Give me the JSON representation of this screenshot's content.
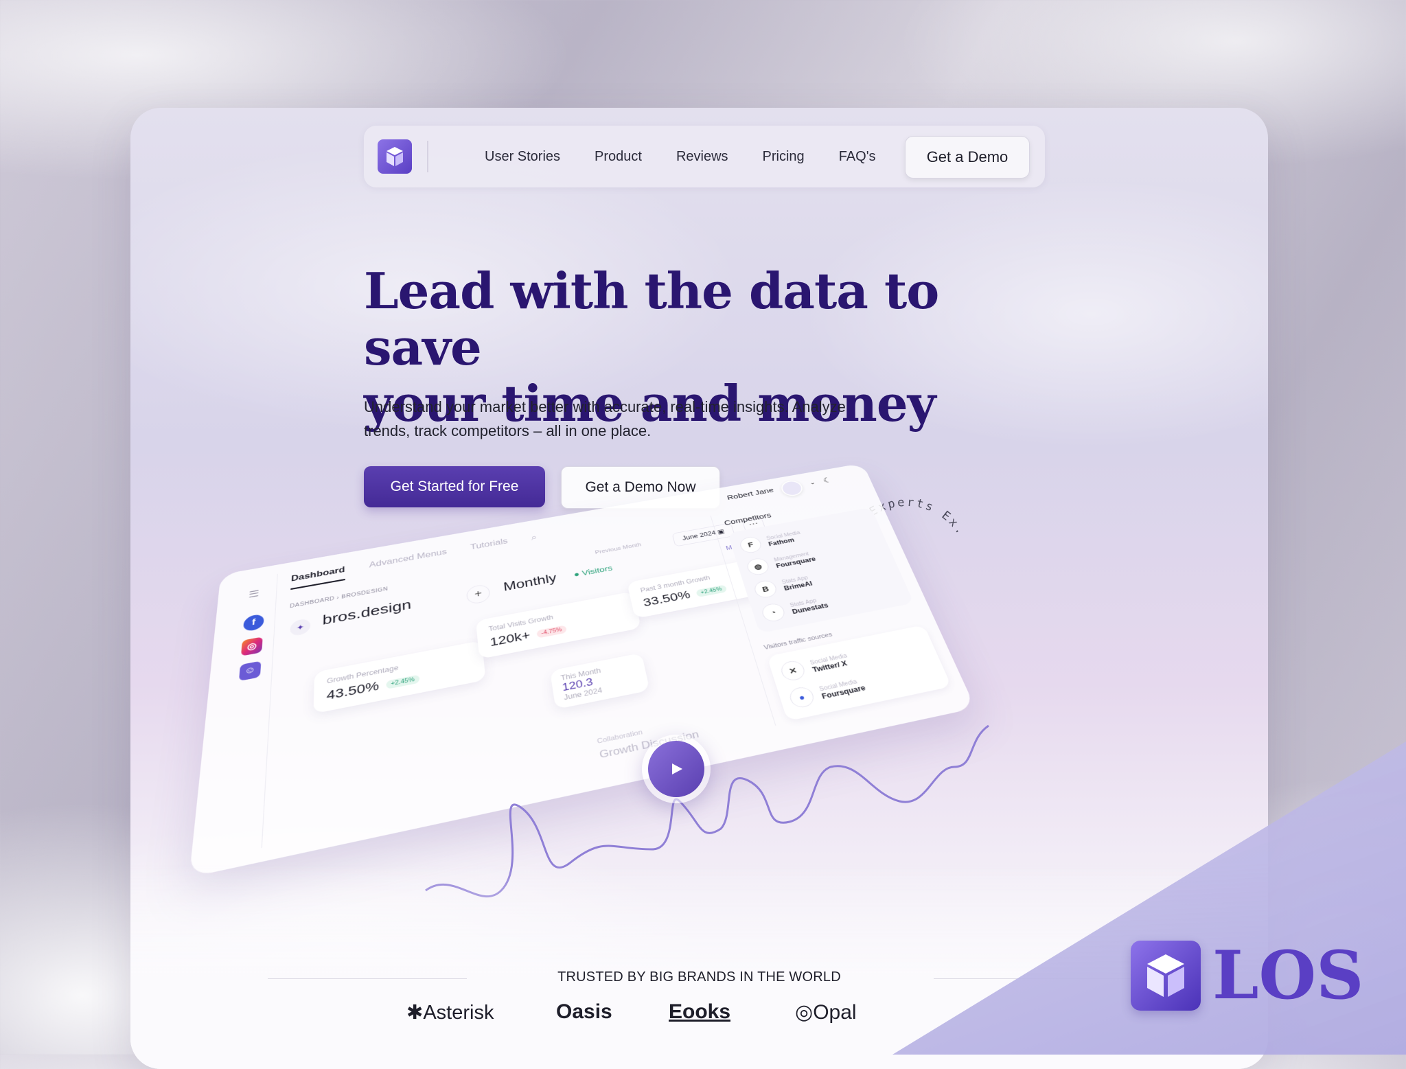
{
  "nav": {
    "links": [
      "User Stories",
      "Product",
      "Reviews",
      "Pricing",
      "FAQ's"
    ],
    "cta": "Get a Demo"
  },
  "hero": {
    "headline_line1": "Lead with the data to save",
    "headline_line2": "your time and money",
    "subtitle": "Understand your market better with accurate, real-time insights. Analyze trends, track competitors – all in one place.",
    "primary_cta": "Get Started for Free",
    "secondary_cta": "Get a Demo Now",
    "circular_badge": "Lead Experts Ex."
  },
  "dashboard": {
    "user": "Robert Jane",
    "tabs": [
      "Dashboard",
      "Advanced Menus",
      "Tutorials"
    ],
    "breadcrumb": "DASHBOARD  ›  BROSDESIGN",
    "site": "bros.design",
    "period": "Monthly",
    "visitors_label": "Visitors",
    "date": "June 2024",
    "previous_label": "Previous Month",
    "monthly_select": "Monthly",
    "cards": [
      {
        "label": "Growth Percentage",
        "value": "43.50%",
        "badge": "+2.45%",
        "trend": "up"
      },
      {
        "label": "Total Visits Growth",
        "value": "120k+",
        "badge": "-4.75%",
        "trend": "down"
      },
      {
        "label": "Past 3 month Growth",
        "value": "33.50%",
        "badge": "+2.45%",
        "trend": "up"
      }
    ],
    "tooltip": {
      "label": "This Month",
      "value": "120.3",
      "date": "June 2024"
    },
    "competitors": {
      "title": "Competitors",
      "items": [
        {
          "category": "Social Media",
          "name": "Fathom",
          "icon": "fathom-icon"
        },
        {
          "category": "Management",
          "name": "Foursquare",
          "icon": "globe-icon"
        },
        {
          "category": "Stats App",
          "name": "BrimeAI",
          "icon": "brime-icon"
        },
        {
          "category": "Stats App",
          "name": "Dunestats",
          "icon": "dune-icon"
        }
      ],
      "traffic_title": "Visitors traffic sources",
      "traffic_items": [
        {
          "category": "Social Media",
          "name": "Twitter/ X",
          "icon": "x-icon"
        },
        {
          "category": "Social Media",
          "name": "Foursquare",
          "icon": "foursquare-icon"
        }
      ]
    },
    "collab_label": "Collaboration",
    "discussion": "Growth Discussion",
    "sidebar_icons": [
      "menu-icon",
      "facebook-icon",
      "instagram-icon",
      "discord-icon"
    ]
  },
  "trusted": {
    "title": "TRUSTED BY BIG BRANDS IN THE WORLD",
    "brands": [
      "Asterisk",
      "Oasis",
      "Eooks",
      "Opal"
    ]
  },
  "watermark": {
    "text": "LOS"
  },
  "colors": {
    "primary": "#4b2f9e",
    "headline": "#2a1670",
    "positive": "#2fa37c",
    "negative": "#e0506a",
    "chart_line": "#8f7fd6"
  }
}
